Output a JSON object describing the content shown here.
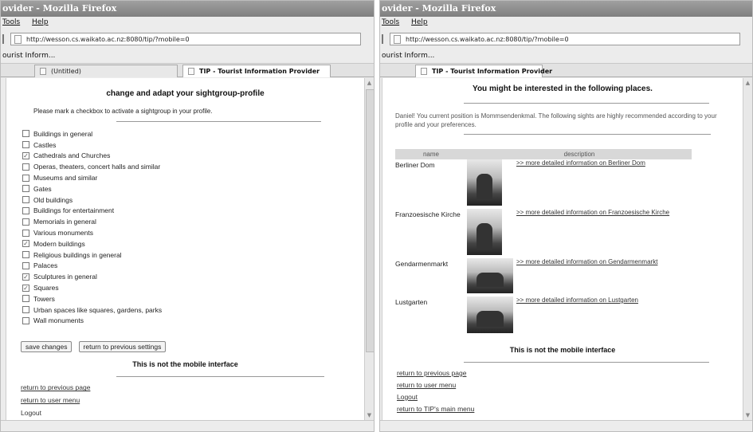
{
  "left": {
    "title": "ovider - Mozilla Firefox",
    "menu": [
      "Tools",
      "Help"
    ],
    "url": "http://wesson.cs.waikato.ac.nz:8080/tip/?mobile=0",
    "bookmark": "ourist Inform...",
    "tabs": [
      "(Untitled)",
      "TIP - Tourist Information Provider"
    ],
    "heading": "change and adapt your sightgroup-profile",
    "instruction": "Please mark a checkbox to activate a sightgroup in your profile.",
    "groups": [
      {
        "label": "Buildings in general",
        "checked": false
      },
      {
        "label": "Castles",
        "checked": false
      },
      {
        "label": "Cathedrals and Churches",
        "checked": true
      },
      {
        "label": "Operas, theaters, concert halls and similar",
        "checked": false
      },
      {
        "label": "Museums and similar",
        "checked": false
      },
      {
        "label": "Gates",
        "checked": false
      },
      {
        "label": "Old buildings",
        "checked": false
      },
      {
        "label": "Buildings for entertainment",
        "checked": false
      },
      {
        "label": "Memorials in general",
        "checked": false
      },
      {
        "label": "Various monuments",
        "checked": false
      },
      {
        "label": "Modern buildings",
        "checked": true
      },
      {
        "label": "Religious buildings in general",
        "checked": false
      },
      {
        "label": "Palaces",
        "checked": false
      },
      {
        "label": "Sculptures in general",
        "checked": true
      },
      {
        "label": "Squares",
        "checked": true
      },
      {
        "label": "Towers",
        "checked": false
      },
      {
        "label": "Urban spaces like squares, gardens, parks",
        "checked": false
      },
      {
        "label": "Wall monuments",
        "checked": false
      }
    ],
    "save_button": "save changes",
    "return_settings_button": "return to previous settings",
    "not_mobile": "This is not the mobile interface",
    "links": [
      "return to previous page",
      "return to user menu",
      "Logout"
    ]
  },
  "right": {
    "title": "ovider - Mozilla Firefox",
    "menu": [
      "Tools",
      "Help"
    ],
    "url": "http://wesson.cs.waikato.ac.nz:8080/tip/?mobile=0",
    "bookmark": "ourist Inform...",
    "tabs": [
      "TIP - Tourist Information Provider"
    ],
    "heading": "You might be interested in the following places.",
    "message": "Daniel! You current position is Mommsendenkmal. The following sights are highly recommended according to your profile and your preferences.",
    "table_headers": [
      "name",
      "description"
    ],
    "places": [
      {
        "name": "Berliner Dom",
        "link": ">> more detailed information on Berliner Dom"
      },
      {
        "name": "Franzoesische Kirche",
        "link": ">> more detailed information on Franzoesische Kirche"
      },
      {
        "name": "Gendarmenmarkt",
        "link": ">> more detailed information on Gendarmenmarkt"
      },
      {
        "name": "Lustgarten",
        "link": ">> more detailed information on Lustgarten"
      }
    ],
    "not_mobile": "This is not the mobile interface",
    "links": [
      "return to previous page",
      "return to user menu",
      "Logout",
      "return to TIP's main menu"
    ]
  }
}
